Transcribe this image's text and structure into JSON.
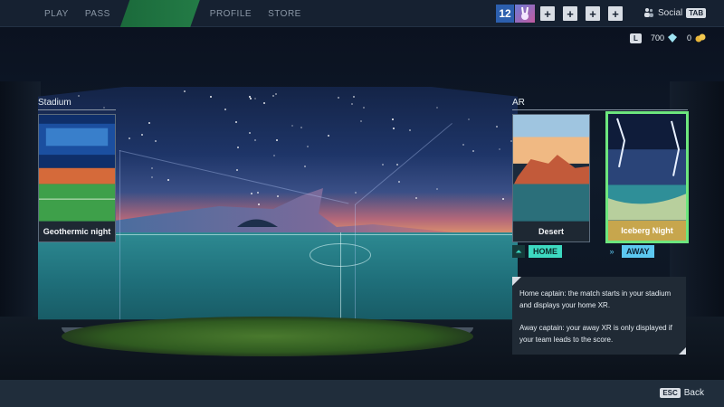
{
  "nav": {
    "items": [
      {
        "label": "PLAY",
        "active": false
      },
      {
        "label": "PASS",
        "active": false
      },
      {
        "label": "",
        "active": true
      },
      {
        "label": "PROFILE",
        "active": false
      },
      {
        "label": "STORE",
        "active": false
      }
    ]
  },
  "player": {
    "level": "12",
    "social_label": "Social",
    "social_key": "TAB"
  },
  "currency": {
    "league_badge": "L",
    "gems": "700",
    "coins": "0"
  },
  "stadium": {
    "title": "Stadium",
    "card_label": "Geothermic night"
  },
  "ar": {
    "title": "AR",
    "cards": [
      {
        "label": "Desert",
        "selected": false
      },
      {
        "label": "Iceberg Night",
        "selected": true
      }
    ],
    "home_tag": "HOME",
    "away_tag": "AWAY"
  },
  "info": {
    "home_text": "Home captain: the match starts in your stadium and displays your home XR.",
    "away_text": "Away captain: your away XR is only displayed if your team leads to the score."
  },
  "footer": {
    "back_key": "ESC",
    "back_label": "Back"
  },
  "colors": {
    "accent_green": "#6de67e",
    "home_tag": "#3dd9c1",
    "away_tag": "#5cc8f0",
    "topbar": "#162131",
    "selected_label": "#c7a64d"
  }
}
